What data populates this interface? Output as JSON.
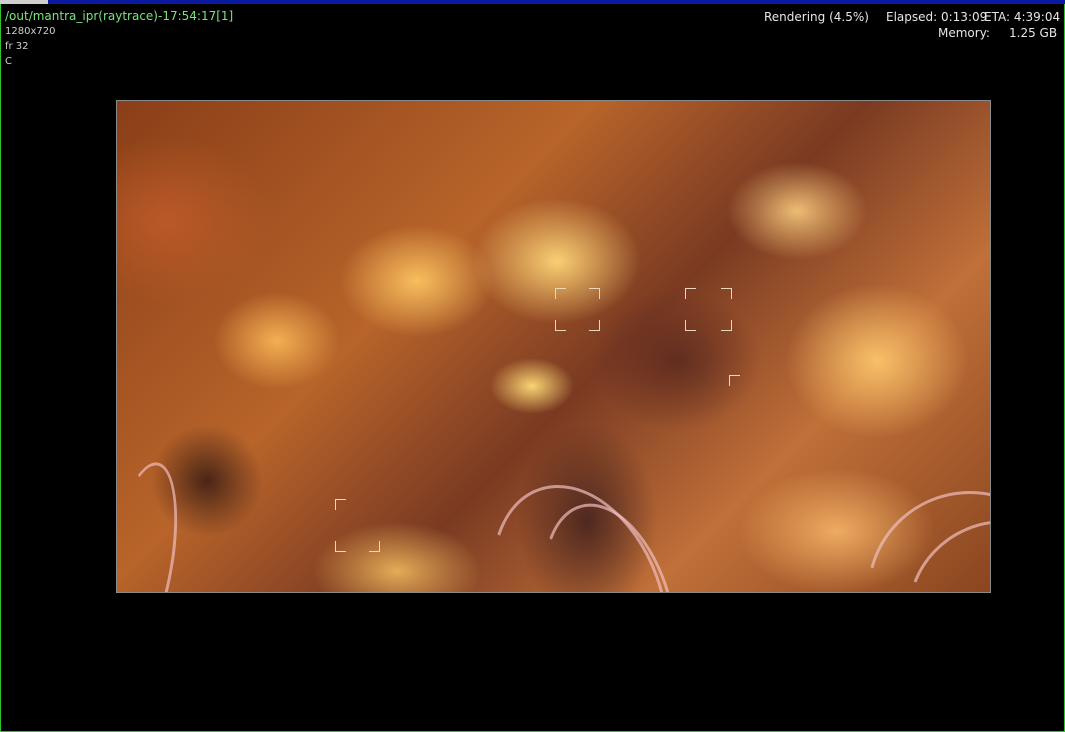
{
  "header": {
    "title": "/out/mantra_ipr(raytrace)-17:54:17[1]",
    "resolution": "1280x720",
    "frame": "fr 32",
    "channel": "C"
  },
  "status": {
    "rendering": "Rendering (4.5%)",
    "elapsed": "Elapsed: 0:13:09",
    "eta": "ETA: 4:39:04",
    "memory_label": "Memory:",
    "memory_value": "1.25 GB",
    "progress_fraction": 0.045
  },
  "colors": {
    "frame_border": "#2fc42f",
    "title_text": "#7be37b",
    "progress_bar_bg": "#0a1aa0"
  }
}
